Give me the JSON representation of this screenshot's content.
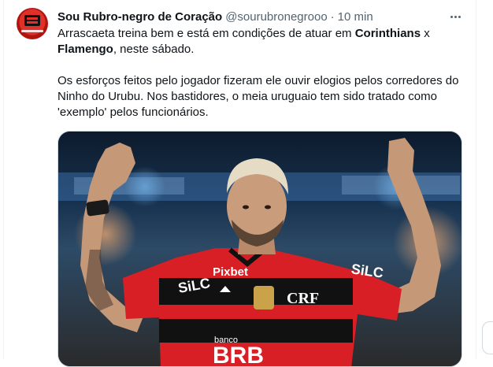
{
  "tweet": {
    "display_name": "Sou Rubro-negro de Coração",
    "handle": "@sourubronegrooo",
    "separator": "·",
    "time": "10 min",
    "text": {
      "p1_a": "Arrascaeta treina bem e está em condições de atuar em ",
      "p1_b": "Corinthians",
      "p1_c": " x ",
      "p1_d": "Flamengo",
      "p1_e": ", neste sábado.",
      "p2": "Os esforços feitos pelo jogador fizeram ele ouvir elogios pelos corredores do Ninho do Urubu. Nos bastidores, o meia uruguaio tem sido tratado como 'exemplo' pelos funcionários."
    },
    "jersey": {
      "left_sponsor": "SiLC",
      "chest_sponsor": "Pixbet",
      "bank_label": "banco",
      "bank_name": "BRB",
      "crest": "CRF",
      "right_sponsor": "SiLC"
    }
  },
  "icons": {
    "more": "more-horizontal-icon",
    "avatar": "profile-avatar"
  },
  "colors": {
    "text": "#0f1419",
    "secondary": "#536471",
    "border": "#cfd9de",
    "jersey_red": "#d91f26",
    "jersey_black": "#111111"
  }
}
